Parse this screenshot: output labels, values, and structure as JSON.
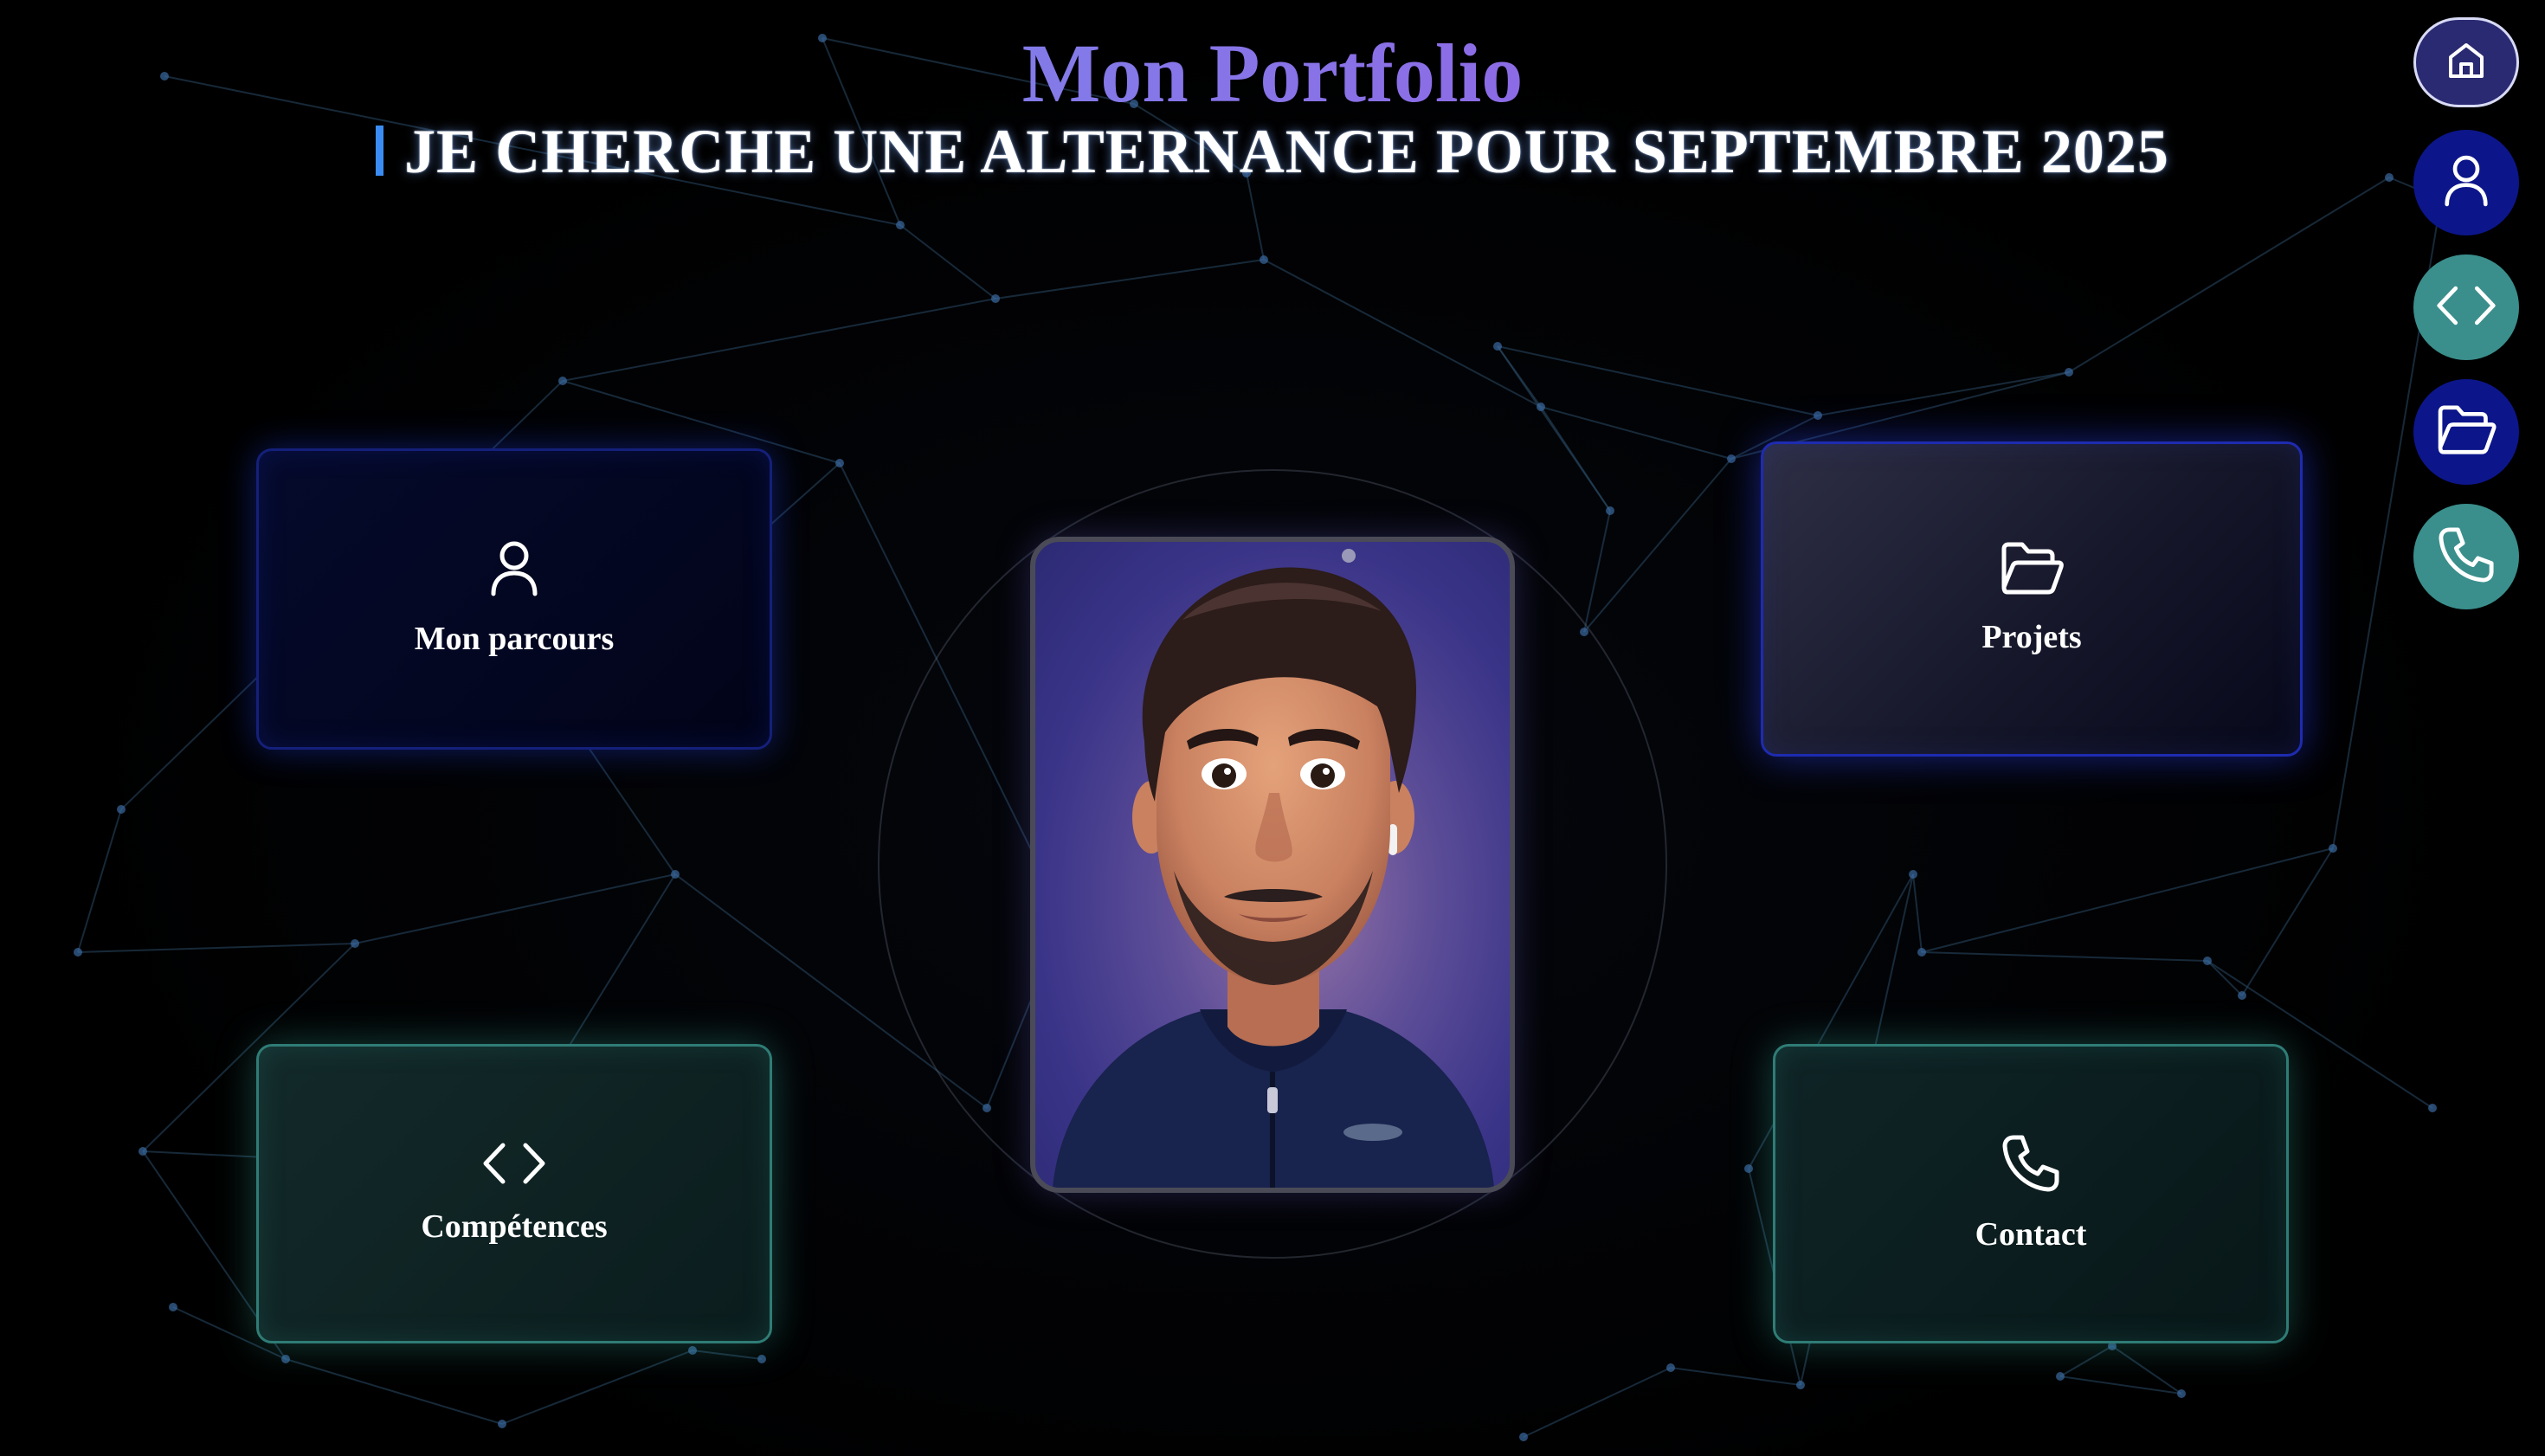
{
  "header": {
    "title": "Mon Portfolio",
    "subtitle": "JE CHERCHE UNE ALTERNANCE POUR SEPTEMBRE 2025"
  },
  "cards": {
    "parcours": {
      "label": "Mon parcours",
      "icon": "user-icon"
    },
    "projets": {
      "label": "Projets",
      "icon": "folder-open-icon"
    },
    "competences": {
      "label": "Compétences",
      "icon": "code-icon"
    },
    "contact": {
      "label": "Contact",
      "icon": "phone-icon"
    }
  },
  "portrait": {
    "icon": "avatar-portrait"
  },
  "nav": {
    "items": [
      {
        "icon": "home-icon",
        "color": "#2a2a72"
      },
      {
        "icon": "user-icon",
        "color": "#0c168a"
      },
      {
        "icon": "code-icon",
        "color": "#3a8f8c"
      },
      {
        "icon": "folder-open-icon",
        "color": "#0c168a"
      },
      {
        "icon": "phone-icon",
        "color": "#3a8f8c"
      }
    ]
  },
  "colors": {
    "title_gradient_start": "#6f9cf0",
    "title_gradient_end": "#a04fe0",
    "cursor": "#3b8cf2",
    "network_lines": "#2a4a66",
    "network_nodes": "#3a6aa0"
  }
}
